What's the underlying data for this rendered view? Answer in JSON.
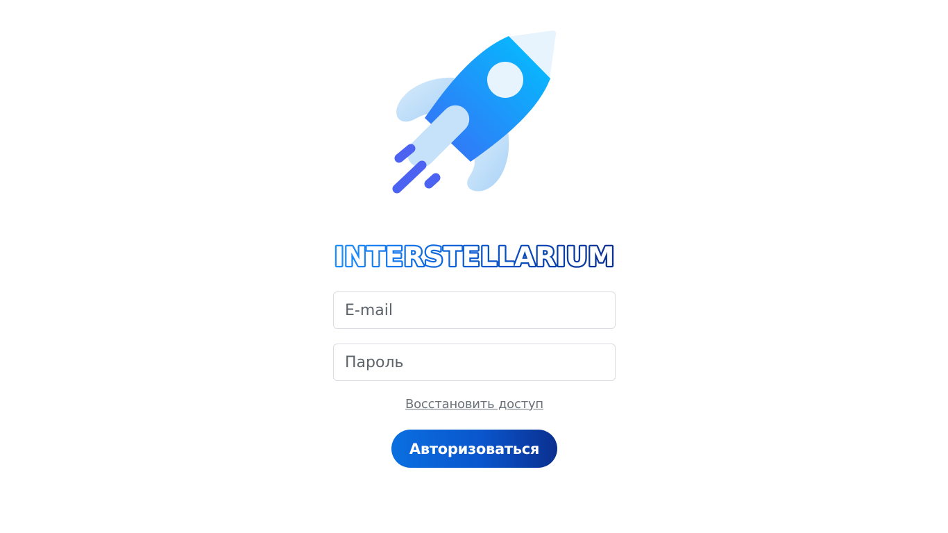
{
  "brand": {
    "logo_text": "INTERSTELLARIUM",
    "logo_gradient": [
      "#1e8fff",
      "#0b2f8f"
    ]
  },
  "login_form": {
    "email_placeholder": "E-mail",
    "password_placeholder": "Пароль",
    "restore_link": "Восстановить доступ",
    "submit_label": "Авторизоваться"
  },
  "icons": {
    "hero": "rocket-icon"
  },
  "colors": {
    "primary": "#0a5fd8",
    "primary_dark": "#0b2f8f",
    "rocket_body": "#1e8fff",
    "rocket_accent": "#4b63f0",
    "text_muted": "#6b7178",
    "border": "#d9dce0"
  }
}
